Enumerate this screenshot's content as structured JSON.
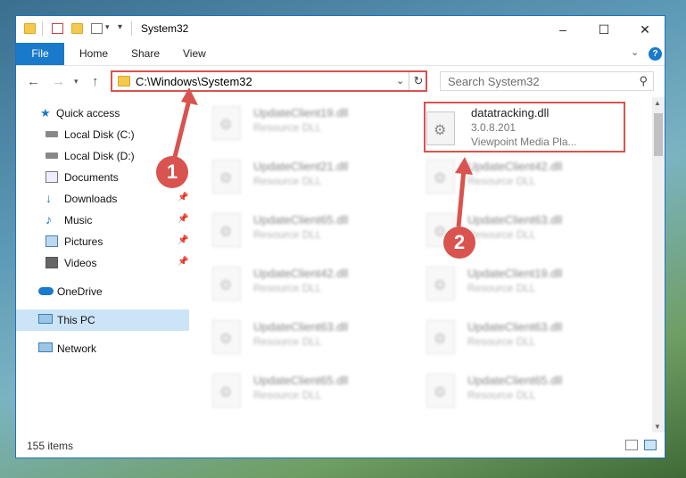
{
  "window": {
    "title": "System32",
    "controls": {
      "minimize": "–",
      "maximize": "☐",
      "close": "✕"
    }
  },
  "ribbon": {
    "tabs": [
      "File",
      "Home",
      "Share",
      "View"
    ]
  },
  "navigation": {
    "address": "C:\\Windows\\System32",
    "search_placeholder": "Search System32"
  },
  "sidebar": {
    "items": [
      {
        "label": "Quick access",
        "icon": "star-icon",
        "pinned": false
      },
      {
        "label": "Local Disk (C:)",
        "icon": "drive-icon",
        "pinned": false
      },
      {
        "label": "Local Disk (D:)",
        "icon": "drive-icon",
        "pinned": false
      },
      {
        "label": "Documents",
        "icon": "documents-icon",
        "pinned": true
      },
      {
        "label": "Downloads",
        "icon": "download-icon",
        "pinned": true
      },
      {
        "label": "Music",
        "icon": "music-icon",
        "pinned": true
      },
      {
        "label": "Pictures",
        "icon": "pictures-icon",
        "pinned": true
      },
      {
        "label": "Videos",
        "icon": "videos-icon",
        "pinned": true
      },
      {
        "label": "OneDrive",
        "icon": "cloud-icon",
        "pinned": false
      },
      {
        "label": "This PC",
        "icon": "computer-icon",
        "pinned": false,
        "selected": true
      },
      {
        "label": "Network",
        "icon": "network-icon",
        "pinned": false
      }
    ]
  },
  "files": {
    "highlighted": {
      "name": "datatracking.dll",
      "version": "3.0.8.201",
      "description": "Viewpoint Media Pla..."
    },
    "left_column": [
      {
        "name": "UpdateClient19.dll",
        "type": "Resource DLL"
      },
      {
        "name": "UpdateClient21.dll",
        "type": "Resource DLL"
      },
      {
        "name": "UpdateClient65.dll",
        "type": "Resource DLL"
      },
      {
        "name": "UpdateClient42.dll",
        "type": "Resource DLL"
      },
      {
        "name": "UpdateClient63.dll",
        "type": "Resource DLL"
      },
      {
        "name": "UpdateClient65.dll",
        "type": "Resource DLL"
      }
    ],
    "right_column": [
      {
        "name": "UpdateClient42.dll",
        "type": "Resource DLL"
      },
      {
        "name": "UpdateClient63.dll",
        "type": "Resource DLL"
      },
      {
        "name": "UpdateClient19.dll",
        "type": "Resource DLL"
      },
      {
        "name": "UpdateClient63.dll",
        "type": "Resource DLL"
      },
      {
        "name": "UpdateClient65.dll",
        "type": "Resource DLL"
      }
    ]
  },
  "status": {
    "item_count": "155 items"
  },
  "callouts": [
    "1",
    "2"
  ],
  "colors": {
    "accent": "#1979ca",
    "annotation": "#d9534f",
    "selected": "#cce4f7"
  }
}
